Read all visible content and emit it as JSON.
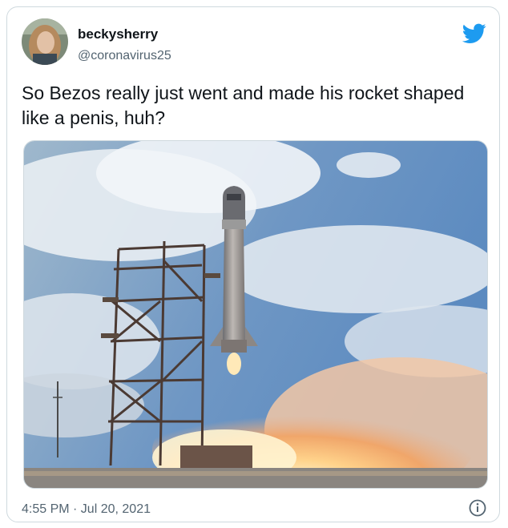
{
  "tweet": {
    "display_name": "beckysherry",
    "handle": "@coronavirus25",
    "text": "So Bezos really just went and made his rocket shaped like a penis, huh?",
    "timestamp": "4:55 PM · Jul 20, 2021"
  },
  "icons": {
    "brand": "twitter-bird-icon",
    "info": "info-icon"
  },
  "colors": {
    "twitter_blue": "#1d9bf0",
    "text_primary": "#0f1419",
    "text_secondary": "#536471",
    "border": "#cfd9de"
  }
}
